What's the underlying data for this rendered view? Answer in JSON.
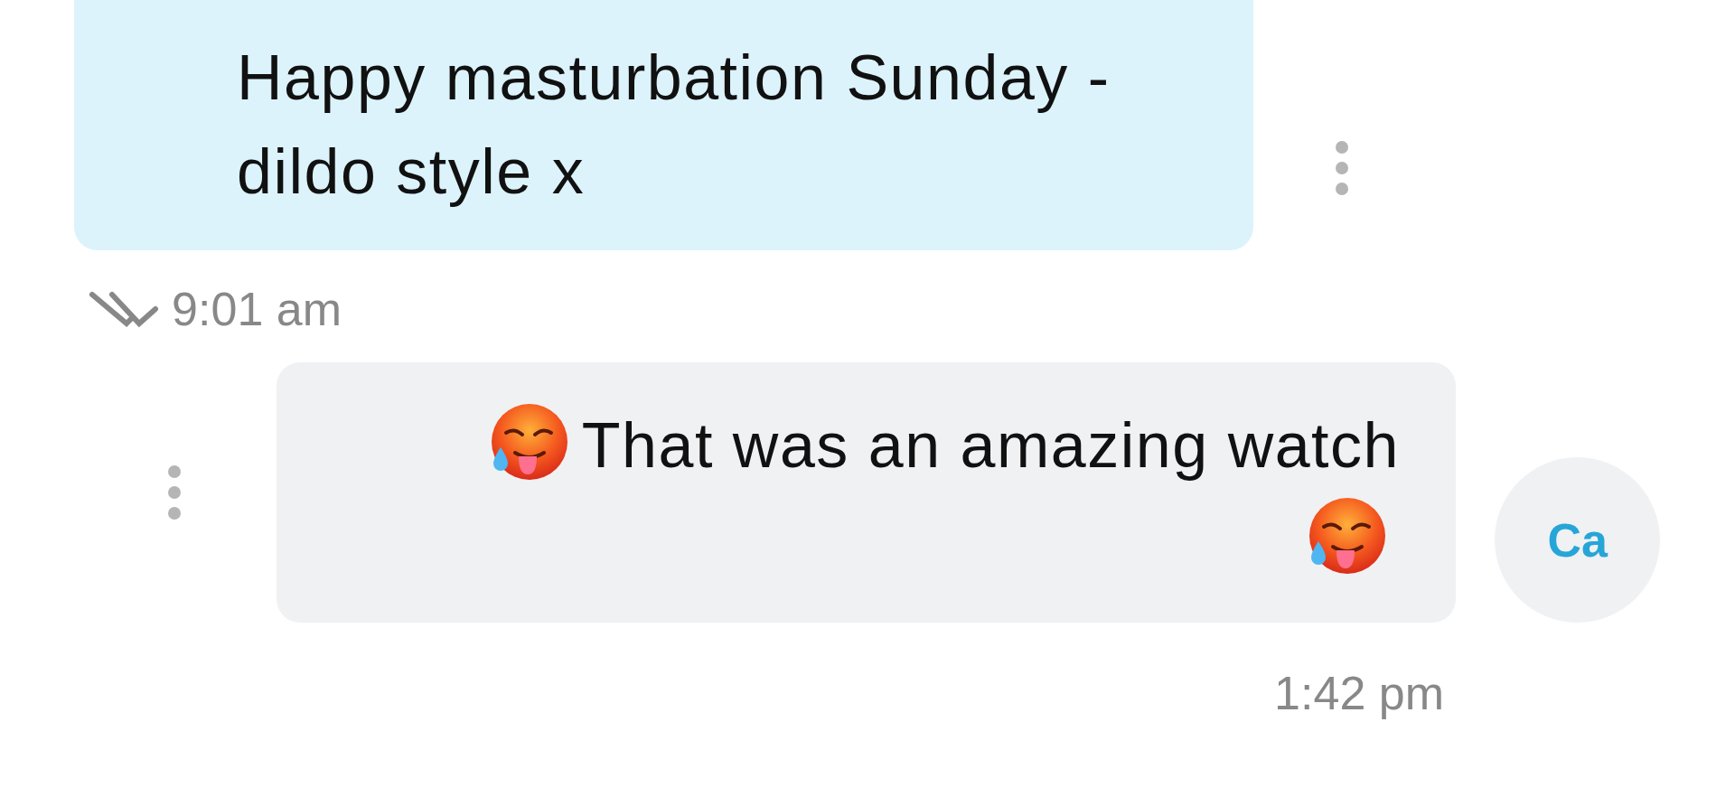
{
  "messages": [
    {
      "kind": "sent",
      "text": "Happy masturbation Sunday - dildo style x",
      "time": "9:01 am",
      "read": true
    },
    {
      "kind": "received",
      "avatar": "Ca",
      "text": "That was an amazing watch",
      "time": "1:42 pm"
    }
  ]
}
